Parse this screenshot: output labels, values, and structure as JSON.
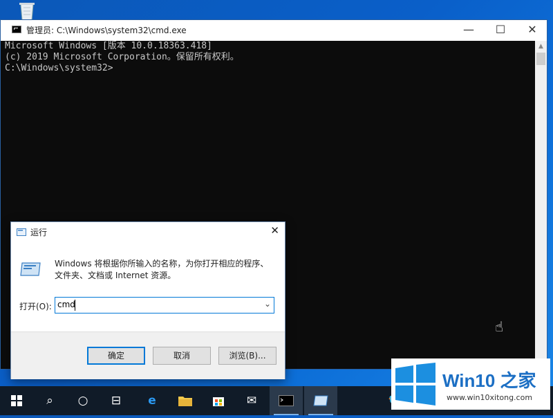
{
  "cmd": {
    "title": "管理员: C:\\Windows\\system32\\cmd.exe",
    "lines": [
      "Microsoft Windows [版本 10.0.18363.418]",
      "(c) 2019 Microsoft Corporation。保留所有权利。",
      "",
      "C:\\Windows\\system32>"
    ],
    "minimize": "—",
    "maximize": "☐",
    "close": "✕"
  },
  "run": {
    "title": "运行",
    "description": "Windows 将根据你所输入的名称，为你打开相应的程序、文件夹、文档或 Internet 资源。",
    "open_label": "打开(O):",
    "input_value": "cmd",
    "ok": "确定",
    "cancel": "取消",
    "browse": "浏览(B)...",
    "close": "✕"
  },
  "taskbar": {
    "items": [
      "start-icon",
      "search-icon",
      "cortana-icon",
      "task-view-icon",
      "edge-icon",
      "explorer-icon",
      "store-icon",
      "mail-icon",
      "cmd-icon",
      "run-icon"
    ]
  },
  "watermark": {
    "title": "Win10 之家",
    "url": "www.win10xitong.com"
  },
  "colors": {
    "desktop": "#0a5fc9",
    "console_bg": "#0c0c0c",
    "console_text": "#c8c8c8",
    "taskbar": "#101b28",
    "accent": "#0078d7"
  }
}
